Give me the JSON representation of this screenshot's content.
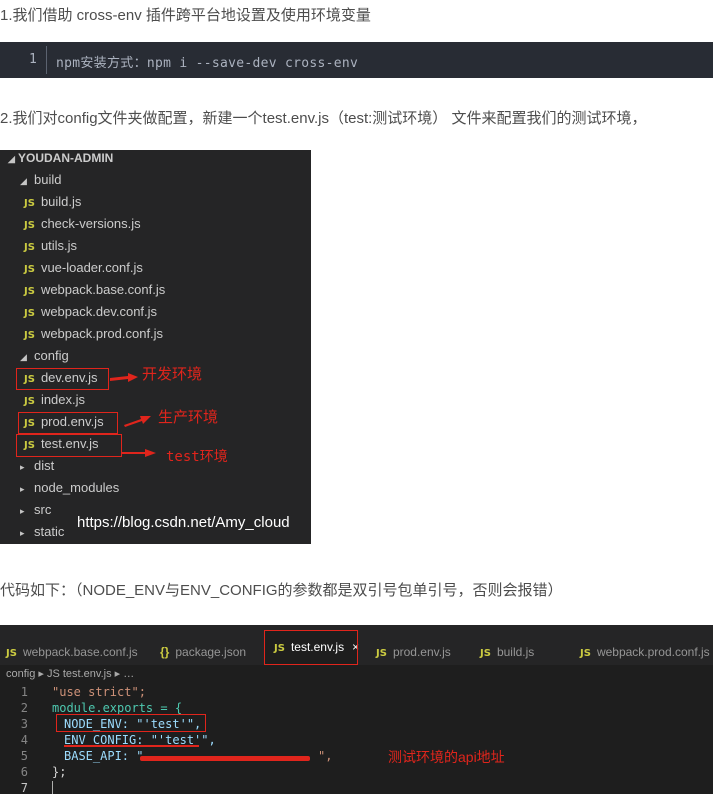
{
  "step1": "1.我们借助 cross-env 插件跨平台地设置及使用环境变量",
  "install": {
    "line_number": "1",
    "code": "npm安装方式：npm i --save-dev cross-env"
  },
  "step2": "2.我们对config文件夹做配置，新建一个test.env.js（test:测试环境） 文件来配置我们的测试环境，",
  "explorer": {
    "root": "YOUDAN-ADMIN",
    "build_folder": "build",
    "build_files": [
      "build.js",
      "check-versions.js",
      "utils.js",
      "vue-loader.conf.js",
      "webpack.base.conf.js",
      "webpack.dev.conf.js",
      "webpack.prod.conf.js"
    ],
    "config_folder": "config",
    "config_files": [
      "dev.env.js",
      "index.js",
      "prod.env.js",
      "test.env.js"
    ],
    "other_folders": [
      "dist",
      "node_modules",
      "src",
      "static"
    ],
    "js_badge": "JS",
    "watermark": "https://blog.csdn.net/Amy_cloud"
  },
  "annotations": {
    "dev": "开发环境",
    "prod": "生产环境",
    "test": "test环境",
    "api": "测试环境的api地址"
  },
  "code_intro": "代码如下：（NODE_ENV与ENV_CONFIG的参数都是双引号包单引号，否则会报错）",
  "editor": {
    "tabs": [
      "webpack.base.conf.js",
      "package.json",
      "test.env.js",
      "prod.env.js",
      "build.js",
      "webpack.prod.conf.js"
    ],
    "close_glyph": "×",
    "breadcrumb": "config ▸ JS test.env.js ▸ …",
    "lines": [
      {
        "n": "1",
        "text": "\"use strict\";"
      },
      {
        "n": "2",
        "text": "module.exports = {"
      },
      {
        "n": "3",
        "text": "NODE_ENV: \"'test'\","
      },
      {
        "n": "4",
        "text": "ENV_CONFIG: \"'test'\","
      },
      {
        "n": "5",
        "text": "BASE_API: \""
      },
      {
        "n": "6",
        "text": "};"
      },
      {
        "n": "7",
        "text": ""
      }
    ]
  },
  "colors": {
    "accent_red": "#e0251c",
    "js_badge": "#cbcb41",
    "explorer_bg": "#252526",
    "code_bg": "#282c34"
  }
}
